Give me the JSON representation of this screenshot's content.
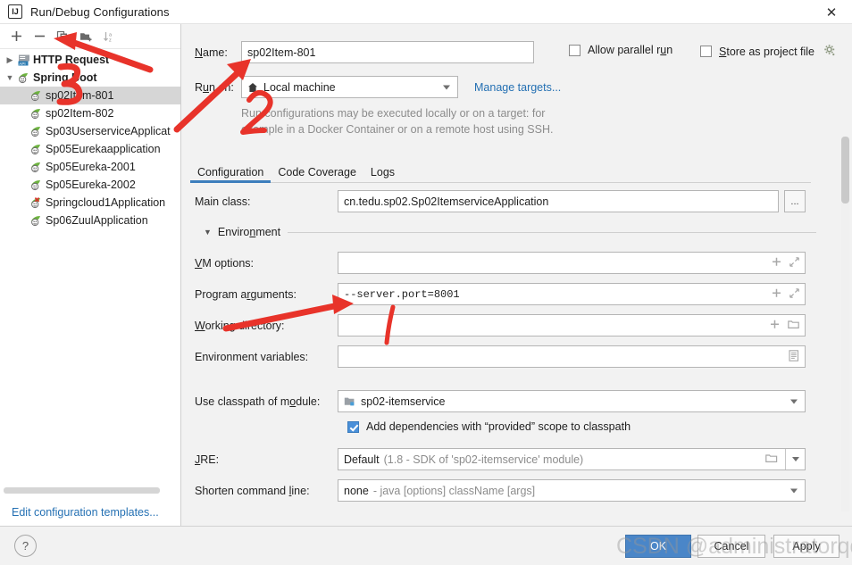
{
  "window": {
    "title": "Run/Debug Configurations",
    "app_icon": "intellij-idea-icon",
    "close_label": "✕"
  },
  "sidebar": {
    "toolbar": [
      {
        "name": "add-configuration-button",
        "icon": "plus-icon",
        "glyph": "+"
      },
      {
        "name": "remove-configuration-button",
        "icon": "minus-icon",
        "glyph": "−"
      },
      {
        "name": "copy-configuration-button",
        "icon": "copy-icon",
        "glyph": ""
      },
      {
        "name": "new-folder-button",
        "icon": "new-folder-icon",
        "glyph": ""
      },
      {
        "name": "sort-configurations-button",
        "icon": "sort-az-icon",
        "glyph": ""
      }
    ],
    "tree": [
      {
        "label": "HTTP Request",
        "icon": "http-request-icon",
        "level": 0,
        "twisty": "collapsed",
        "bold": true,
        "selected": false,
        "error": false
      },
      {
        "label": "Spring Boot",
        "icon": "spring-boot-icon",
        "level": 0,
        "twisty": "expanded",
        "bold": true,
        "selected": false,
        "error": false
      },
      {
        "label": "sp02Item-801",
        "icon": "spring-boot-icon",
        "level": 1,
        "twisty": "none",
        "bold": false,
        "selected": true,
        "error": false
      },
      {
        "label": "sp02Item-802",
        "icon": "spring-boot-icon",
        "level": 1,
        "twisty": "none",
        "bold": false,
        "selected": false,
        "error": false
      },
      {
        "label": "Sp03UserserviceApplicat",
        "icon": "spring-boot-icon",
        "level": 1,
        "twisty": "none",
        "bold": false,
        "selected": false,
        "error": false
      },
      {
        "label": "Sp05Eurekaapplication",
        "icon": "spring-boot-icon",
        "level": 1,
        "twisty": "none",
        "bold": false,
        "selected": false,
        "error": false
      },
      {
        "label": "Sp05Eureka-2001",
        "icon": "spring-boot-icon",
        "level": 1,
        "twisty": "none",
        "bold": false,
        "selected": false,
        "error": false
      },
      {
        "label": "Sp05Eureka-2002",
        "icon": "spring-boot-icon",
        "level": 1,
        "twisty": "none",
        "bold": false,
        "selected": false,
        "error": false
      },
      {
        "label": "Springcloud1Application",
        "icon": "spring-boot-error-icon",
        "level": 1,
        "twisty": "none",
        "bold": false,
        "selected": false,
        "error": true
      },
      {
        "label": "Sp06ZuulApplication",
        "icon": "spring-boot-icon",
        "level": 1,
        "twisty": "none",
        "bold": false,
        "selected": false,
        "error": false
      }
    ],
    "edit_templates_link": "Edit configuration templates..."
  },
  "form": {
    "name_label": "Name:",
    "name_value": "sp02Item-801",
    "allow_parallel_run_label": "Allow parallel run",
    "allow_parallel_run_checked": false,
    "store_as_project_file_label": "Store as project file",
    "store_as_project_file_checked": false,
    "gear_icon": "gear-icon",
    "run_on_label": "Run on:",
    "run_on_value": "Local machine",
    "run_on_icon": "home-icon",
    "manage_targets_link": "Manage targets...",
    "hint_line1": "Run configurations may be executed locally or on a target: for",
    "hint_line2": "example in a Docker Container or on a remote host using SSH.",
    "tabs": [
      {
        "label": "Configuration",
        "active": true
      },
      {
        "label": "Code Coverage",
        "active": false
      },
      {
        "label": "Logs",
        "active": false
      }
    ],
    "main_class_label": "Main class:",
    "main_class_value": "cn.tedu.sp02.Sp02ItemserviceApplication",
    "main_class_browse_label": "...",
    "environment_section_label": "Environment",
    "vm_options_label": "VM options:",
    "vm_options_value": "",
    "program_arguments_label": "Program arguments:",
    "program_arguments_value": "--server.port=8001",
    "working_directory_label": "Working directory:",
    "working_directory_value": "",
    "environment_variables_label": "Environment variables:",
    "environment_variables_value": "",
    "use_classpath_label": "Use classpath of module:",
    "use_classpath_value": "sp02-itemservice",
    "use_classpath_icon": "module-icon",
    "add_dependencies_label": "Add dependencies with “provided” scope to classpath",
    "add_dependencies_checked": true,
    "jre_label": "JRE:",
    "jre_value": "Default",
    "jre_value_hint": "(1.8 - SDK of 'sp02-itemservice' module)",
    "shorten_label": "Shorten command line:",
    "shorten_value": "none",
    "shorten_value_hint": "- java [options] className [args]"
  },
  "footer": {
    "help_label": "?",
    "ok_label": "OK",
    "cancel_label": "Cancel",
    "apply_label": "Apply"
  },
  "watermark": {
    "text": "CSDN @administratorqq"
  },
  "annotations": {
    "color": "#e8332a",
    "marks": [
      {
        "name": "arrow-to-copy-button"
      },
      {
        "name": "arrow-to-name-field"
      },
      {
        "name": "digit-3-mark"
      },
      {
        "name": "digit-2-mark"
      },
      {
        "name": "arrow-to-program-arguments"
      },
      {
        "name": "stroke-mark"
      }
    ]
  }
}
